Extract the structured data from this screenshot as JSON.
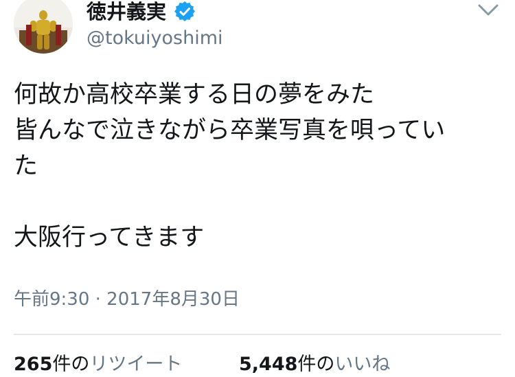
{
  "user": {
    "display_name": "徳井義実",
    "handle": "@tokuiyoshimi",
    "verified_color": "#1da1f2"
  },
  "tweet": {
    "lines": [
      "何故か高校卒業する日の夢をみた",
      "皆んなで泣きながら卒業写真を唄ってい",
      "た",
      "",
      "大阪行ってきます"
    ],
    "timestamp": "午前9:30 · 2017年8月30日"
  },
  "stats": {
    "retweets": {
      "count": "265",
      "unit": "件の",
      "label": "リツイート"
    },
    "likes": {
      "count": "5,448",
      "unit": "件の",
      "label": "いいね"
    }
  },
  "icons": {
    "verified": "verified-badge-icon",
    "more": "chevron-down-icon"
  }
}
